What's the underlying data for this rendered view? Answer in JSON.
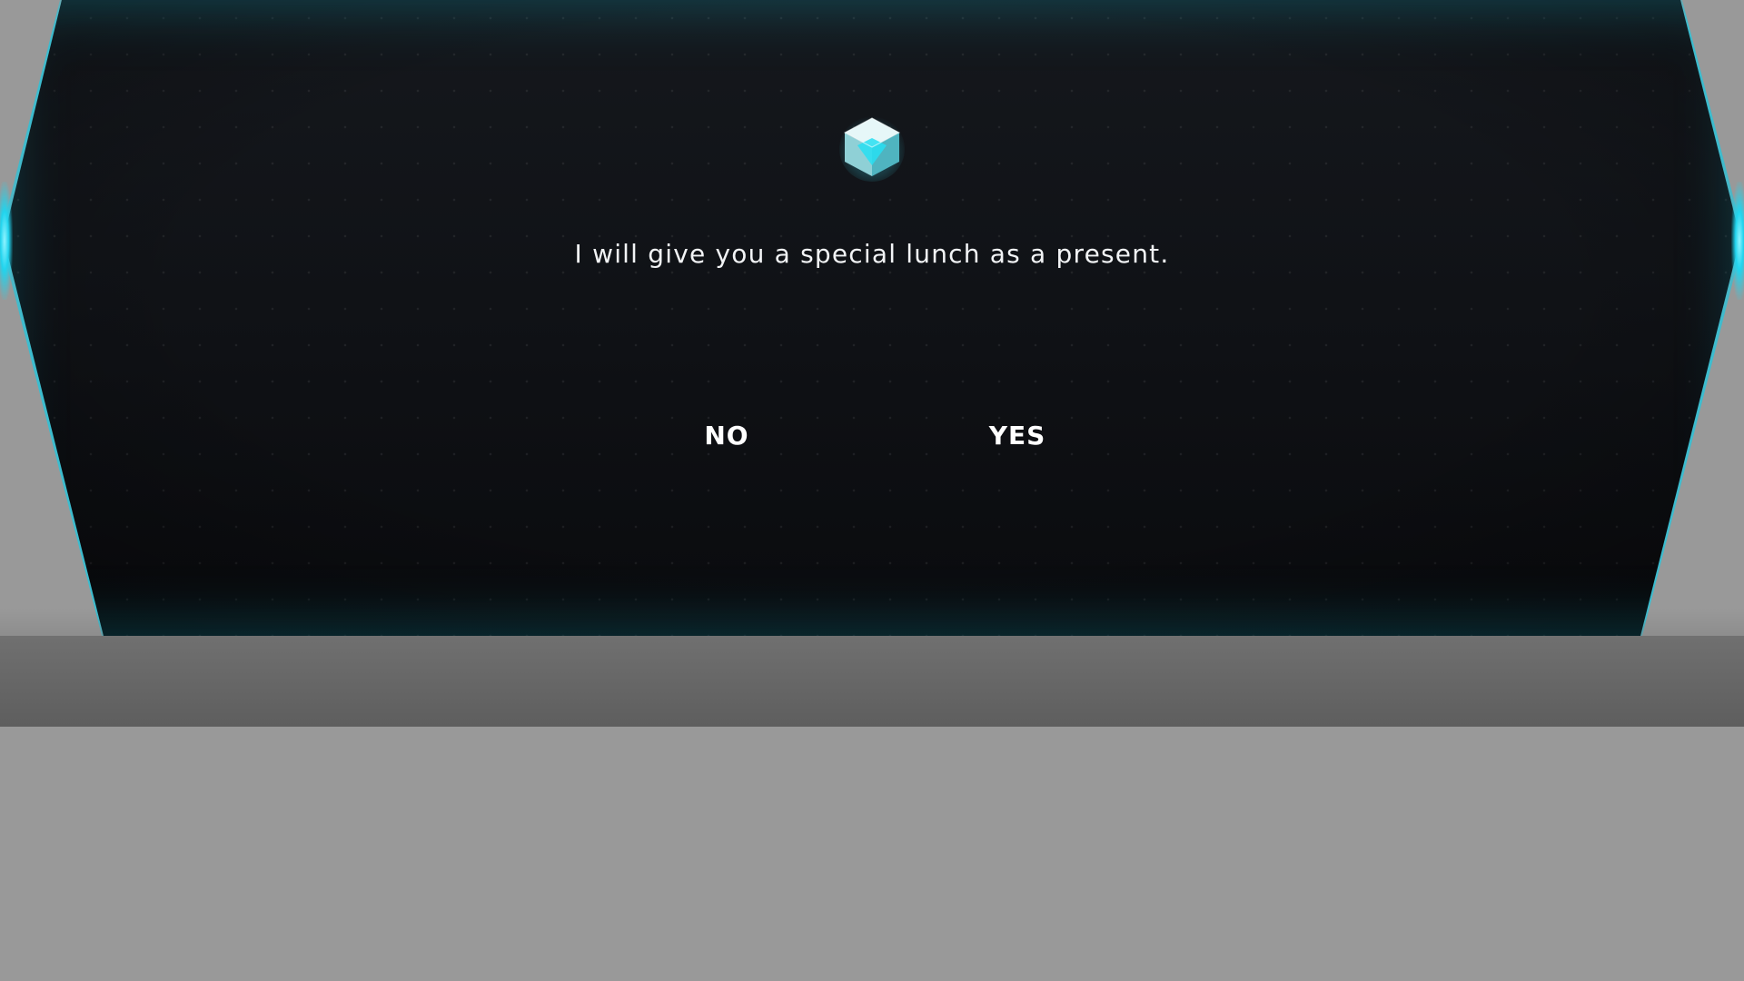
{
  "dialog": {
    "message": "I will give you a special lunch as a present.",
    "icon": "crystal-cube-icon",
    "accent_color": "#1fc8e0"
  },
  "choices": {
    "no_label": "NO",
    "yes_label": "YES"
  },
  "colors": {
    "panel_background": "#0f1115",
    "page_background": "#999999",
    "bottom_bar": "#666666",
    "text": "#f2f4f6"
  }
}
